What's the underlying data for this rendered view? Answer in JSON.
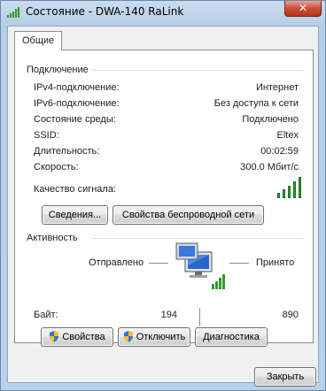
{
  "window": {
    "title": "Состояние - DWA-140 RaLink",
    "close_symbol": "✕"
  },
  "tabs": [
    {
      "label": "Общие",
      "selected": true
    }
  ],
  "connection": {
    "title": "Подключение",
    "rows": [
      {
        "label": "IPv4-подключение:",
        "value": "Интернет"
      },
      {
        "label": "IPv6-подключение:",
        "value": "Без доступа к сети"
      },
      {
        "label": "Состояние среды:",
        "value": "Подключено"
      },
      {
        "label": "SSID:",
        "value": "Eltex"
      },
      {
        "label": "Длительность:",
        "value": "00:02:59"
      },
      {
        "label": "Скорость:",
        "value": "300.0 Мбит/с"
      }
    ],
    "signal_label": "Качество сигнала:",
    "signal_bars": 5,
    "details_button": "Сведения...",
    "wireless_props_button": "Свойства беспроводной сети"
  },
  "activity": {
    "title": "Активность",
    "sent_label": "Отправлено",
    "received_label": "Принято",
    "bytes_label": "Байт:",
    "bytes_sent": "194",
    "bytes_received": "890"
  },
  "buttons": {
    "properties": "Свойства",
    "disable": "Отключить",
    "diagnostics": "Диагностика",
    "close": "Закрыть"
  },
  "colors": {
    "signal_green": "#2f9a2f",
    "window_frame": "#b9d1ea"
  }
}
